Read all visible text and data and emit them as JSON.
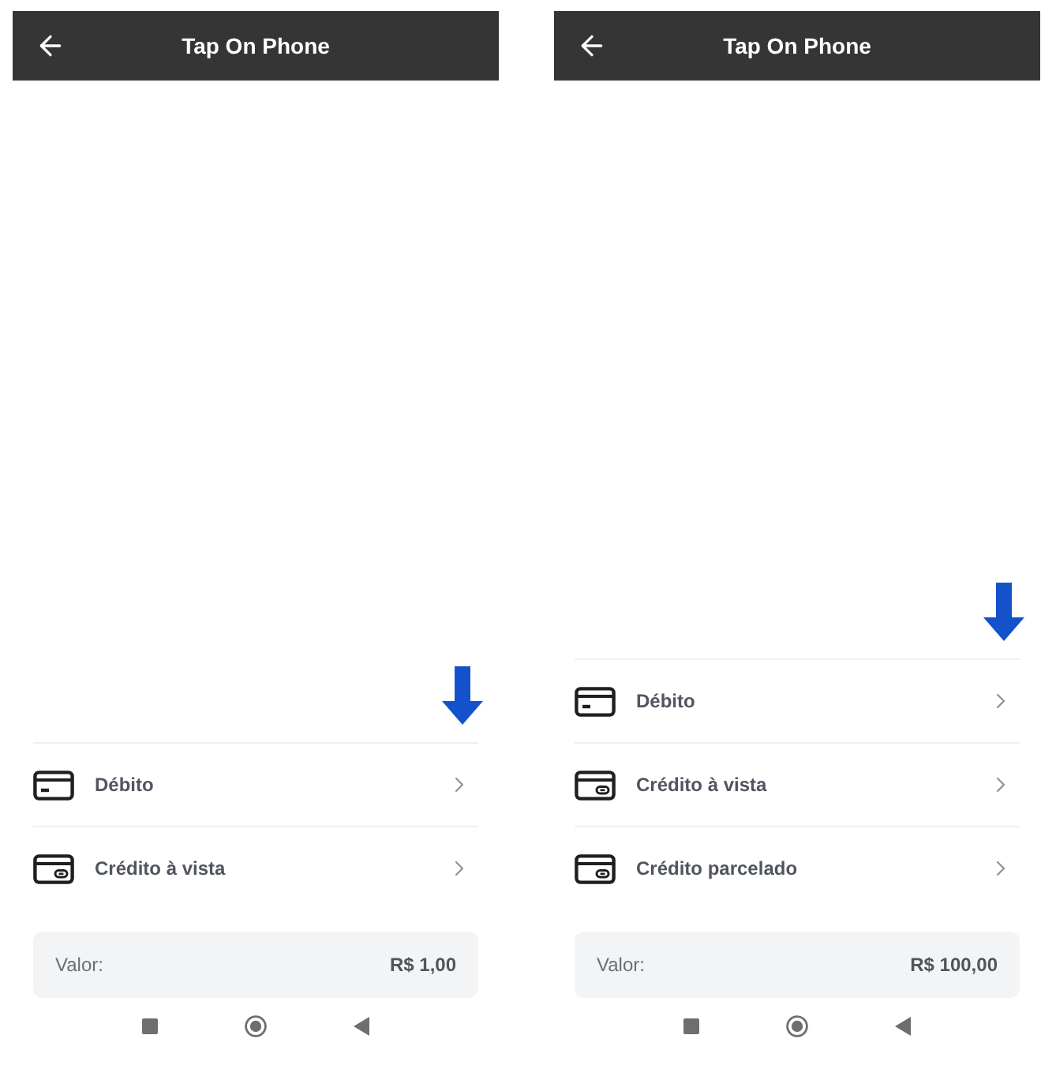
{
  "phones": [
    {
      "header": {
        "title": "Tap On Phone"
      },
      "payment_options": [
        {
          "label": "Débito",
          "kind": "debit"
        },
        {
          "label": "Crédito à vista",
          "kind": "credit"
        }
      ],
      "amount": {
        "label": "Valor:",
        "value": "R$ 1,00"
      }
    },
    {
      "header": {
        "title": "Tap On Phone"
      },
      "payment_options": [
        {
          "label": "Débito",
          "kind": "debit"
        },
        {
          "label": "Crédito à vista",
          "kind": "credit"
        },
        {
          "label": "Crédito parcelado",
          "kind": "credit"
        }
      ],
      "amount": {
        "label": "Valor:",
        "value": "R$ 100,00"
      }
    }
  ]
}
